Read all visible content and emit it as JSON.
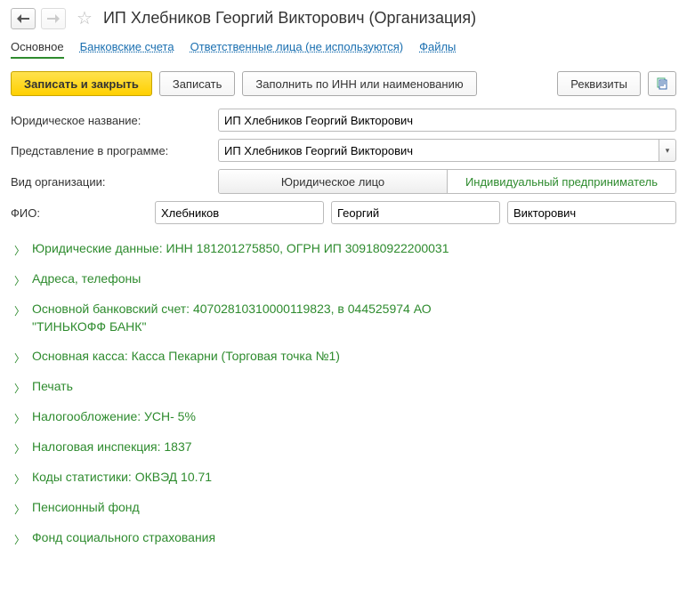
{
  "title": "ИП Хлебников Георгий Викторович (Организация)",
  "tabs": {
    "main": "Основное",
    "bank": "Банковские счета",
    "responsible": "Ответственные лица (не используются)",
    "files": "Файлы"
  },
  "toolbar": {
    "save_close": "Записать и закрыть",
    "save": "Записать",
    "fill_by_inn": "Заполнить по ИНН или наименованию",
    "requisites": "Реквизиты"
  },
  "labels": {
    "legal_name": "Юридическое название:",
    "representation": "Представление в программе:",
    "org_type": "Вид организации:",
    "fio": "ФИО:"
  },
  "fields": {
    "legal_name": "ИП Хлебников Георгий Викторович",
    "representation": "ИП Хлебников Георгий Викторович",
    "lastname": "Хлебников",
    "firstname": "Георгий",
    "patronymic": "Викторович"
  },
  "org_type": {
    "legal": "Юридическое лицо",
    "individual": "Индивидуальный предприниматель"
  },
  "sections": [
    "Юридические данные: ИНН 181201275850, ОГРН ИП 309180922200031",
    "Адреса, телефоны",
    "Основной банковский счет: 40702810310000119823, в 044525974 АО \"ТИНЬКОФФ БАНК\"",
    "Основная касса: Касса Пекарни (Торговая точка №1)",
    "Печать",
    "Налогообложение: УСН- 5%",
    "Налоговая инспекция: 1837",
    "Коды статистики: ОКВЭД 10.71",
    "Пенсионный фонд",
    "Фонд социального страхования"
  ]
}
